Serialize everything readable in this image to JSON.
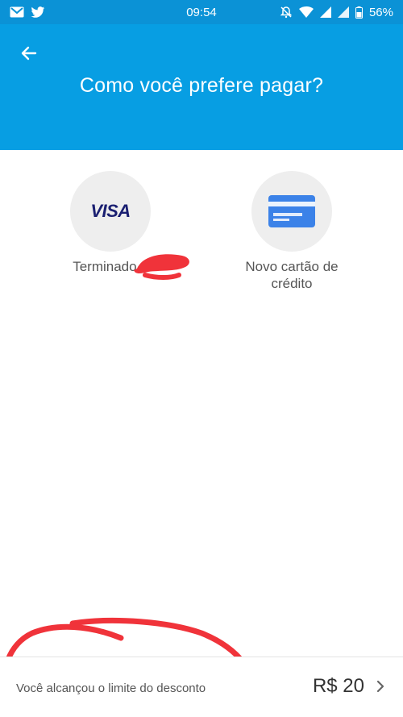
{
  "status_bar": {
    "time": "09:54",
    "battery": "56%",
    "left_icons": [
      "gmail-icon",
      "twitter-icon"
    ],
    "right_icons": [
      "mute-notifications-icon",
      "wifi-icon",
      "signal-icon",
      "signal-icon-2",
      "battery-icon"
    ]
  },
  "header": {
    "title": "Como você prefere pagar?",
    "back_icon": "arrow-left-icon",
    "background_color": "#079ee3"
  },
  "payment_options": [
    {
      "logo_text": "VISA",
      "label": "Terminado e"
    },
    {
      "icon": "credit-card-icon",
      "label": "Novo cartão de\ncrédito"
    }
  ],
  "footer": {
    "message": "Você alcançou o limite do desconto",
    "amount": "R$ 20",
    "chevron_icon": "chevron-right-icon"
  },
  "colors": {
    "accent": "#079ee3",
    "annotation_red": "#f0333a",
    "card_blue": "#3b82e8"
  }
}
